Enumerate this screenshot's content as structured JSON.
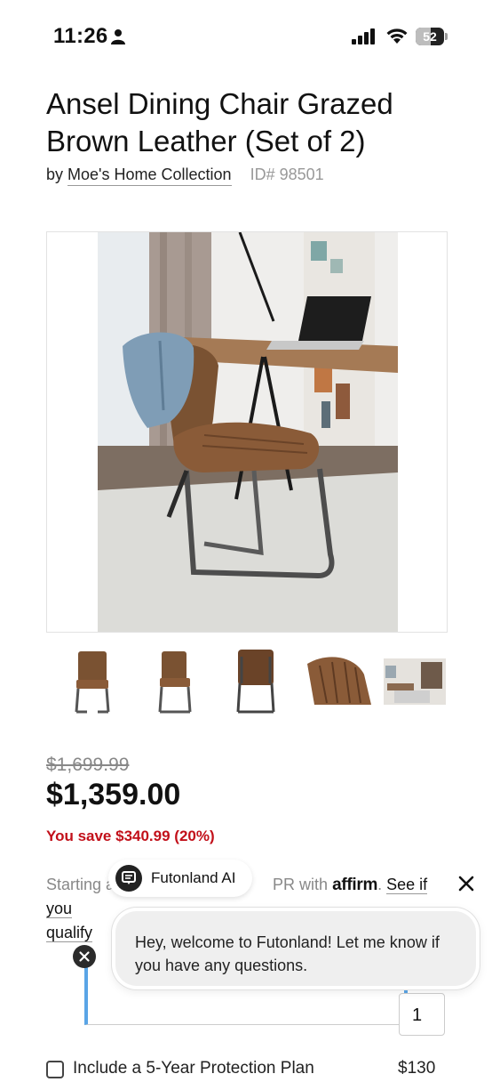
{
  "status_bar": {
    "time": "11:26",
    "battery": "52",
    "battery_level": 0.52
  },
  "product": {
    "title": "Ansel Dining Chair Grazed Brown Leather (Set of 2)",
    "by_label": "by",
    "brand": "Moe's Home Collection",
    "sku": "ID# 98501"
  },
  "thumbnails": [
    {
      "icon": "chair-front-thumb"
    },
    {
      "icon": "chair-side-thumb"
    },
    {
      "icon": "chair-back-thumb"
    },
    {
      "icon": "chair-detail-thumb"
    },
    {
      "icon": "room-scene-thumb"
    }
  ],
  "pricing": {
    "original_price": "$1,699.99",
    "sale_price": "$1,359.00",
    "savings": "You save $340.99 (20%)"
  },
  "financing": {
    "prefix": "Starting a",
    "suffix": "PR with",
    "brand": "affirm",
    "link": "See if you",
    "link2": "qualify"
  },
  "ai_chip": {
    "label": "Futonland AI"
  },
  "chat": {
    "message": "Hey, welcome to Futonland! Let me know if you have any questions."
  },
  "quantity": {
    "value": "1"
  },
  "protection_plan": {
    "label": "Include a 5-Year Protection Plan",
    "price": "$130"
  },
  "colors": {
    "savings_red": "#c2101a",
    "focus_blue": "#5aa5e6"
  }
}
